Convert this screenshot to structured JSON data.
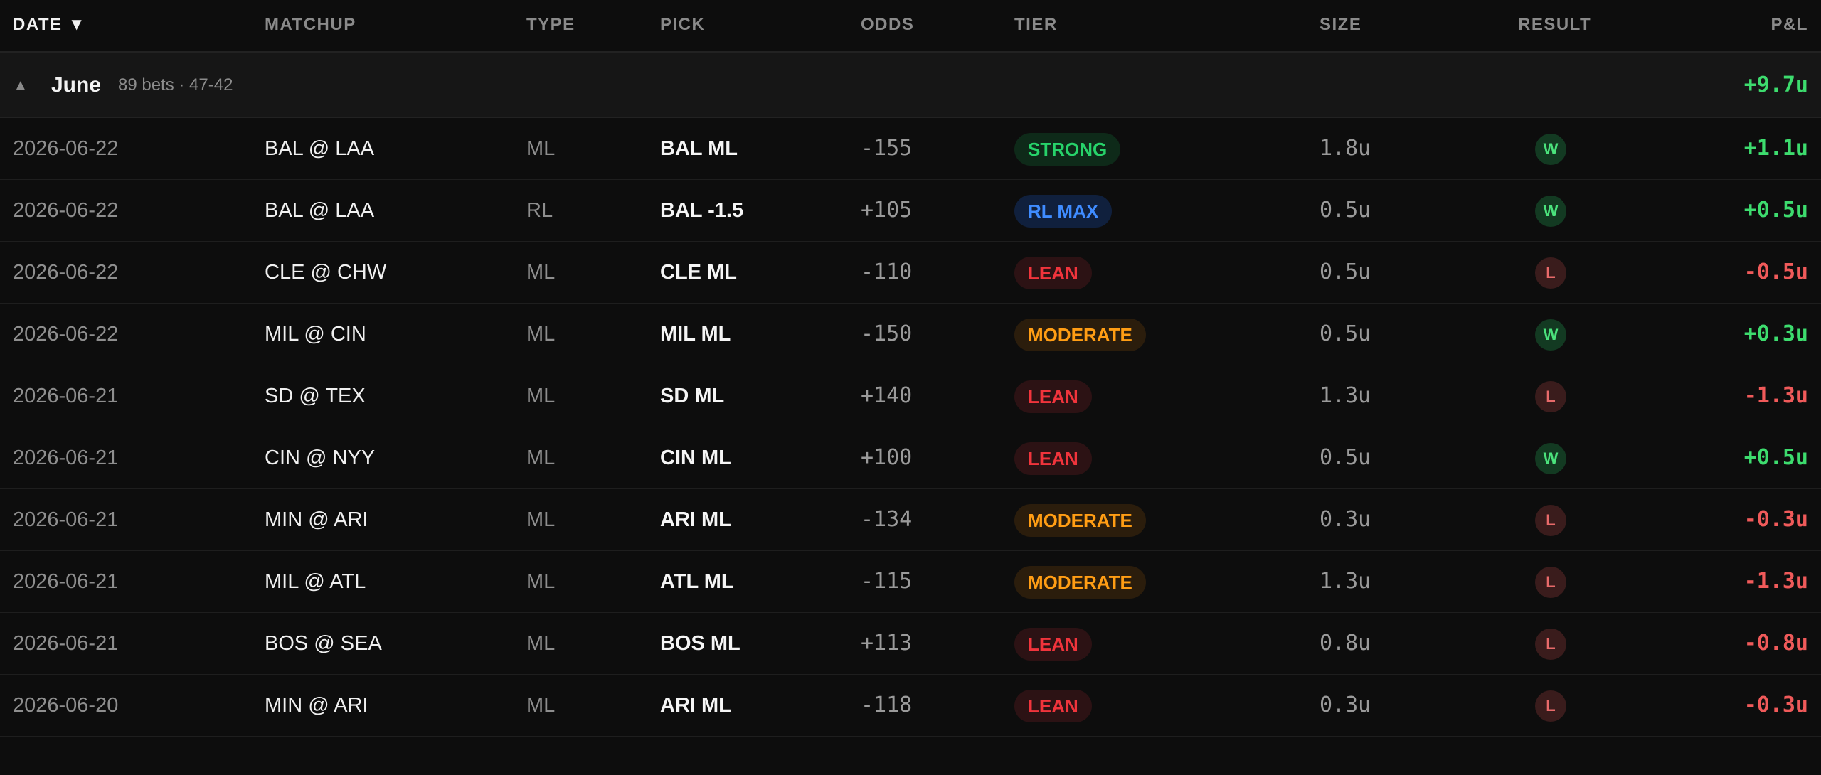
{
  "header": {
    "date": "DATE",
    "sort_indicator": "▼",
    "matchup": "MATCHUP",
    "type": "TYPE",
    "pick": "PICK",
    "odds": "ODDS",
    "tier": "TIER",
    "size": "SIZE",
    "result": "RESULT",
    "pnl": "P&L"
  },
  "group": {
    "caret": "▲",
    "name": "June",
    "meta": "89 bets · 47-42",
    "pnl": "+9.7u"
  },
  "colors": {
    "win": "#3ddc6e",
    "loss": "#f05a5a",
    "strong": "#27d36a",
    "rl_max": "#3f8cff",
    "lean": "#f0343c",
    "moderate": "#ff9d14"
  },
  "rows": [
    {
      "date": "2026-06-22",
      "matchup": "BAL @ LAA",
      "type": "ML",
      "pick": "BAL ML",
      "odds": "-155",
      "tier": "STRONG",
      "tier_class": "strong",
      "size": "1.8u",
      "result": "W",
      "pnl": "+1.1u"
    },
    {
      "date": "2026-06-22",
      "matchup": "BAL @ LAA",
      "type": "RL",
      "pick": "BAL -1.5",
      "odds": "+105",
      "tier": "RL MAX",
      "tier_class": "rlmax",
      "size": "0.5u",
      "result": "W",
      "pnl": "+0.5u"
    },
    {
      "date": "2026-06-22",
      "matchup": "CLE @ CHW",
      "type": "ML",
      "pick": "CLE ML",
      "odds": "-110",
      "tier": "LEAN",
      "tier_class": "lean",
      "size": "0.5u",
      "result": "L",
      "pnl": "-0.5u"
    },
    {
      "date": "2026-06-22",
      "matchup": "MIL @ CIN",
      "type": "ML",
      "pick": "MIL ML",
      "odds": "-150",
      "tier": "MODERATE",
      "tier_class": "moderate",
      "size": "0.5u",
      "result": "W",
      "pnl": "+0.3u"
    },
    {
      "date": "2026-06-21",
      "matchup": "SD @ TEX",
      "type": "ML",
      "pick": "SD ML",
      "odds": "+140",
      "tier": "LEAN",
      "tier_class": "lean",
      "size": "1.3u",
      "result": "L",
      "pnl": "-1.3u"
    },
    {
      "date": "2026-06-21",
      "matchup": "CIN @ NYY",
      "type": "ML",
      "pick": "CIN ML",
      "odds": "+100",
      "tier": "LEAN",
      "tier_class": "lean",
      "size": "0.5u",
      "result": "W",
      "pnl": "+0.5u"
    },
    {
      "date": "2026-06-21",
      "matchup": "MIN @ ARI",
      "type": "ML",
      "pick": "ARI ML",
      "odds": "-134",
      "tier": "MODERATE",
      "tier_class": "moderate",
      "size": "0.3u",
      "result": "L",
      "pnl": "-0.3u"
    },
    {
      "date": "2026-06-21",
      "matchup": "MIL @ ATL",
      "type": "ML",
      "pick": "ATL ML",
      "odds": "-115",
      "tier": "MODERATE",
      "tier_class": "moderate",
      "size": "1.3u",
      "result": "L",
      "pnl": "-1.3u"
    },
    {
      "date": "2026-06-21",
      "matchup": "BOS @ SEA",
      "type": "ML",
      "pick": "BOS ML",
      "odds": "+113",
      "tier": "LEAN",
      "tier_class": "lean",
      "size": "0.8u",
      "result": "L",
      "pnl": "-0.8u"
    },
    {
      "date": "2026-06-20",
      "matchup": "MIN @ ARI",
      "type": "ML",
      "pick": "ARI ML",
      "odds": "-118",
      "tier": "LEAN",
      "tier_class": "lean",
      "size": "0.3u",
      "result": "L",
      "pnl": "-0.3u"
    }
  ]
}
